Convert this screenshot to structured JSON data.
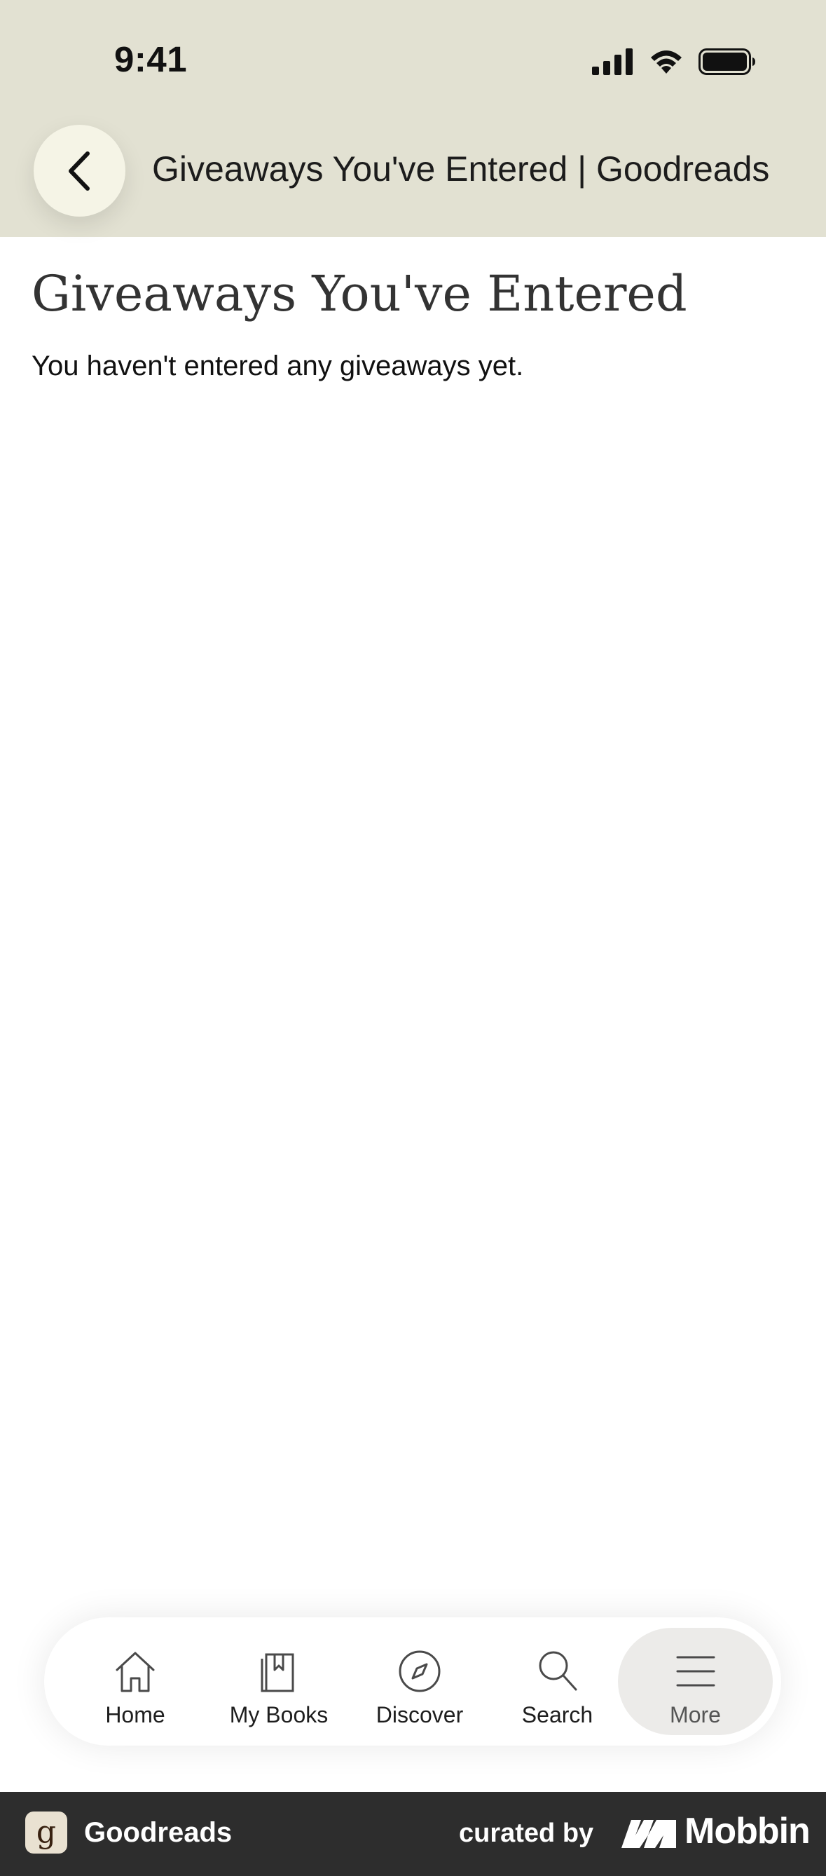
{
  "status_bar": {
    "time": "9:41",
    "icons": [
      "cellular-signal-icon",
      "wifi-icon",
      "battery-icon"
    ]
  },
  "header": {
    "back_icon": "chevron-left-icon",
    "title": "Giveaways You've Entered | Goodreads",
    "background": "#e2e1d2"
  },
  "main": {
    "heading": "Giveaways You've Entered",
    "empty_message": "You haven't entered any giveaways yet."
  },
  "tab_bar": {
    "tabs": [
      {
        "label": "Home",
        "icon": "home-icon",
        "active": false
      },
      {
        "label": "My Books",
        "icon": "books-icon",
        "active": false
      },
      {
        "label": "Discover",
        "icon": "compass-icon",
        "active": false
      },
      {
        "label": "Search",
        "icon": "search-icon",
        "active": false
      },
      {
        "label": "More",
        "icon": "menu-icon",
        "active": true
      }
    ]
  },
  "footer": {
    "brand_logo_letter": "g",
    "brand_name": "Goodreads",
    "curated_by": "curated by",
    "curator": "Mobbin",
    "background": "#2d2d2d"
  }
}
